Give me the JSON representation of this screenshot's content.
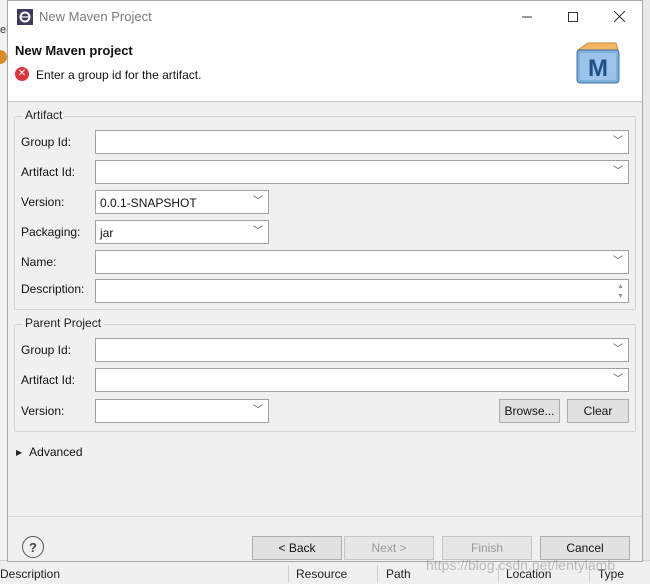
{
  "background": {
    "left_fragment": "el",
    "bottom_columns": [
      "Description",
      "Resource",
      "Path",
      "Location",
      "Type"
    ]
  },
  "window": {
    "title": "New Maven Project",
    "app_icon": "eclipse-icon",
    "controls": {
      "minimize": "—",
      "maximize": "☐",
      "close": "✕"
    }
  },
  "banner": {
    "heading": "New Maven project",
    "message": "Enter a group id for the artifact.",
    "status_icon": "error-icon",
    "wizard_icon_letter": "M"
  },
  "artifact": {
    "legend": "Artifact",
    "group_id": {
      "label": "Group Id:",
      "value": ""
    },
    "artifact_id": {
      "label": "Artifact Id:",
      "value": ""
    },
    "version": {
      "label": "Version:",
      "value": "0.0.1-SNAPSHOT"
    },
    "packaging": {
      "label": "Packaging:",
      "value": "jar"
    },
    "name": {
      "label": "Name:",
      "value": ""
    },
    "description": {
      "label": "Description:",
      "value": ""
    }
  },
  "parent": {
    "legend": "Parent Project",
    "group_id": {
      "label": "Group Id:",
      "value": ""
    },
    "artifact_id": {
      "label": "Artifact Id:",
      "value": ""
    },
    "version": {
      "label": "Version:",
      "value": ""
    },
    "browse_label": "Browse...",
    "clear_label": "Clear"
  },
  "advanced": {
    "label": "Advanced"
  },
  "footer": {
    "help": "?",
    "back_label": "< Back",
    "next_label": "Next >",
    "finish_label": "Finish",
    "cancel_label": "Cancel"
  },
  "watermark": "https://blog.csdn.net/lentylamb",
  "colors": {
    "error": "#d9363e",
    "dialog_bg": "#f0f0f0",
    "accent": "#2a6cb5"
  }
}
